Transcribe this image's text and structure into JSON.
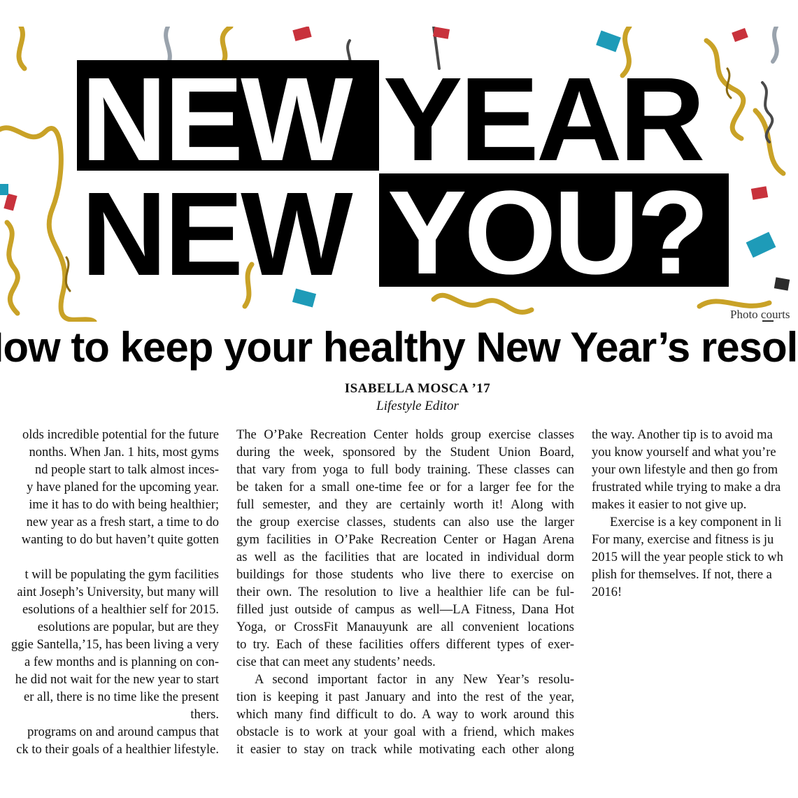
{
  "hero": {
    "line1_word1": "NEW",
    "line1_word2": "YEAR",
    "line2_word1": "NEW",
    "line2_word2": "YOU?",
    "photo_credit": "Photo courts"
  },
  "article": {
    "headline": "How to keep your healthy New Year’s resolut",
    "byline": "ISABELLA MOSCA ’17",
    "role": "Lifestyle Editor"
  },
  "columns": {
    "left": [
      "olds incredible potential for the future",
      "nonths. When Jan. 1 hits, most gyms",
      "nd people start to talk almost inces-",
      "y have planed for the upcoming year.",
      "ime it has to do with being healthier;",
      "new year as a fresh start, a time to do",
      "wanting to do but haven’t quite gotten",
      "",
      "t will be populating the gym facilities",
      "aint Joseph’s University, but many will",
      "esolutions of a healthier self for 2015.",
      "esolutions are popular, but are they",
      "ggie Santella,’15, has been living a very",
      "a few months and is planning on con-",
      "he did not wait for the new year to start",
      "er all, there is no time like the present",
      "thers.",
      "programs on and around campus that",
      "ck to their goals of a healthier lifestyle."
    ],
    "middle": [
      "The O’Pake Recreation Center holds group exercise classes",
      "during the week, sponsored by the Student Union Board,",
      "that vary from yoga to full body training. These classes can",
      "be taken for a small one-time fee or for a larger fee for the",
      "full semester, and they are certainly worth it! Along with",
      "the group exercise classes, students can also use the larger",
      "gym facilities in O’Pake Recreation Center or Hagan Arena",
      "as well as the facilities that are located in individual dorm",
      "buildings for those students who live there to exercise on",
      "their own. The resolution to live a healthier life can be ful-",
      "filled just outside of campus as well—LA Fitness, Dana Hot",
      "Yoga, or CrossFit Manauyunk are all convenient locations",
      "to try. Each of these facilities offers different types of exer-",
      "cise that can meet any students’ needs.",
      "A second important factor in any New Year’s resolu-",
      "tion is keeping it past January and into the rest of the year,",
      "which many find difficult to do. A way to work around this",
      "obstacle is to work at your goal with a friend, which makes",
      "it easier to stay on track while motivating each other along"
    ],
    "right": [
      "the way. Another tip is to avoid ma",
      "you know yourself and what you’re",
      "your own lifestyle and then go from",
      "frustrated while trying to make a dra",
      "makes it easier to not give up.",
      "Exercise is a key component in li",
      "For many, exercise and fitness is ju",
      "2015 will the year people stick to wh",
      "plish for themselves. If not, there a",
      "2016!"
    ]
  }
}
